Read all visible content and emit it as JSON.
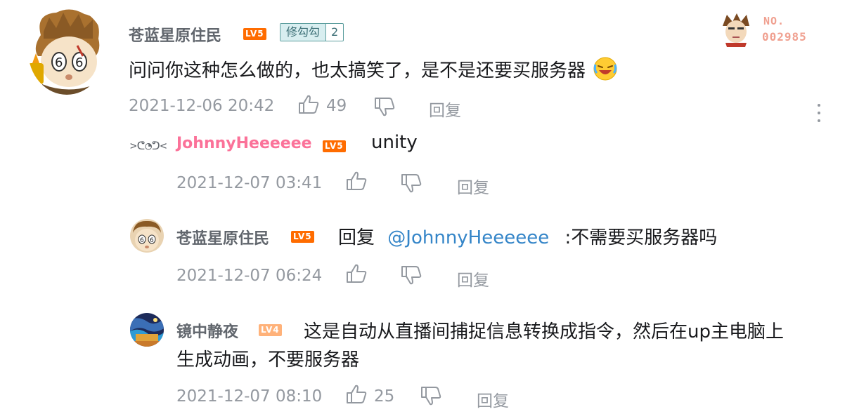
{
  "top_comment": {
    "username": "苍蓝星原住民",
    "level_badge": "LV5",
    "fan_badge": {
      "name": "修勾勾",
      "level": "2"
    },
    "decoration_label": "NO.",
    "decoration_number": "002985",
    "text": "问问你这种怎么做的，也太搞笑了，是不是还要买服务器",
    "timestamp": "2021-12-06 20:42",
    "like_count": "49",
    "reply_label": "回复"
  },
  "replies": [
    {
      "prefix": ">ᕦ◔ᕤ<",
      "username": "JohnnyHeeeeee",
      "level_badge": "LV5",
      "text": "unity",
      "timestamp": "2021-12-07 03:41",
      "reply_label": "回复"
    },
    {
      "username": "苍蓝星原住民",
      "level_badge": "LV5",
      "reply_word": "回复",
      "mention": "@JohnnyHeeeeee",
      "text": ":不需要买服务器吗",
      "timestamp": "2021-12-07 06:24",
      "reply_label": "回复"
    },
    {
      "username": "镜中静夜",
      "level_badge": "LV4",
      "text_line1": "这是自动从直播间捕捉信息转换成指令，然后在up主电脑上",
      "text_line2": "生成动画，不要服务器",
      "timestamp": "2021-12-07 08:10",
      "like_count": "25",
      "reply_label": "回复"
    }
  ],
  "colors": {
    "username_gray": "#61666d",
    "username_pink": "#fb7299",
    "mention_blue": "#3485c8",
    "meta_gray": "#9499a0",
    "level_orange": "#ff6c00"
  },
  "icons": [
    "thumbs-up-icon",
    "thumbs-down-icon",
    "more-vertical-icon"
  ]
}
